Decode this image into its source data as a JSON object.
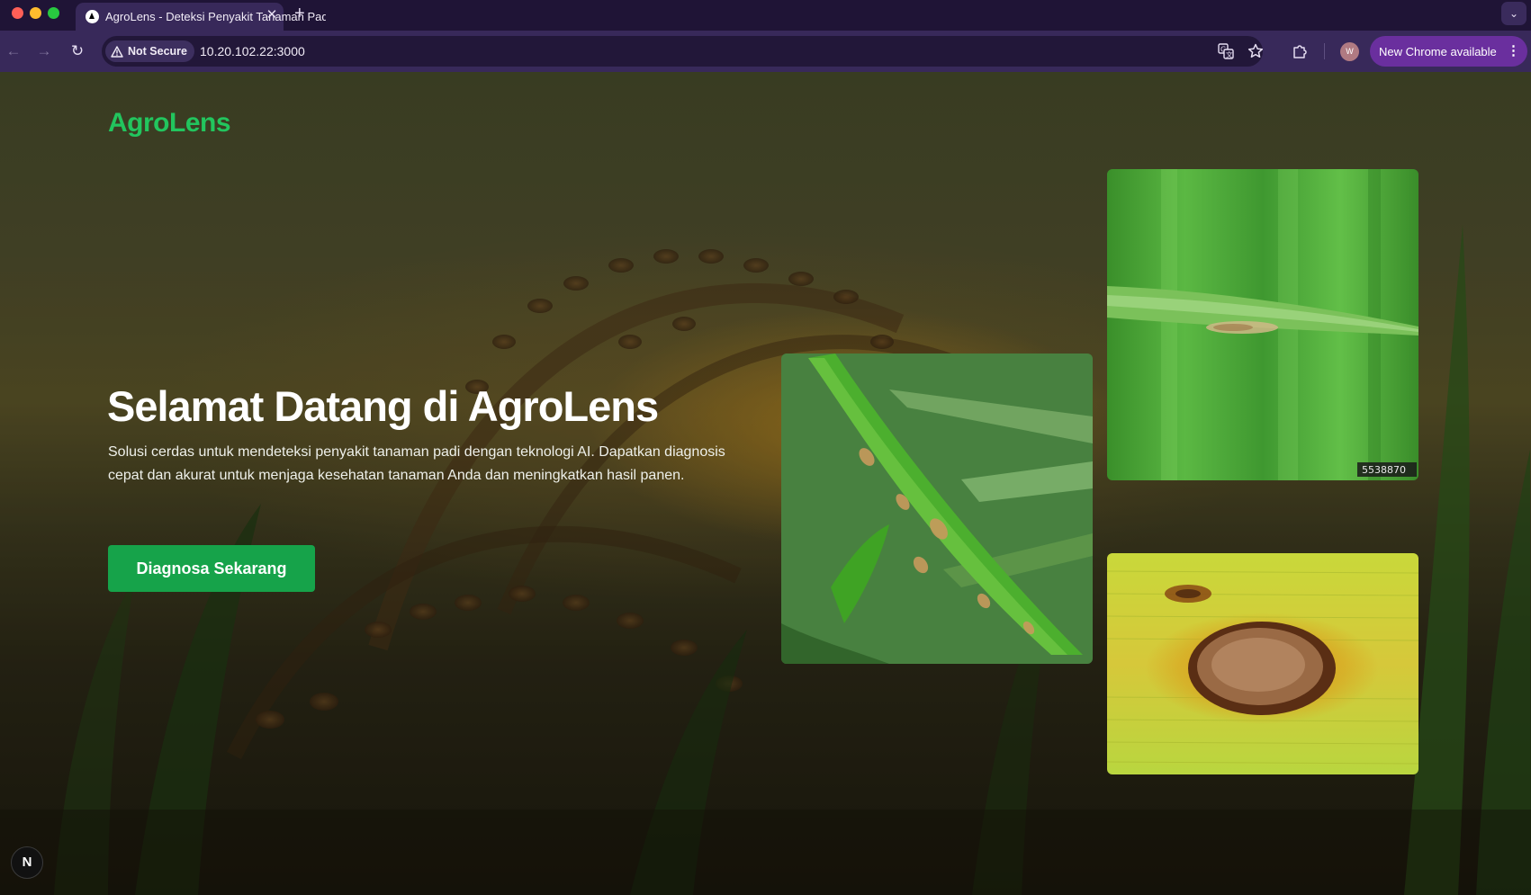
{
  "browser": {
    "tab": {
      "title": "AgroLens - Deteksi Penyakit Tanaman Padi",
      "close_glyph": "✕"
    },
    "new_tab_glyph": "+",
    "tab_menu_glyph": "⌄",
    "nav": {
      "back_glyph": "←",
      "forward_glyph": "→",
      "reload_glyph": "↻"
    },
    "security_label": "Not Secure",
    "url": "10.20.102.22:3000",
    "avatar_initial": "W",
    "update_label": "New Chrome available",
    "update_menu_glyph": "⋮",
    "icons": [
      "warning-triangle-icon",
      "translate-icon",
      "star-icon",
      "extensions-puzzle-icon",
      "kebab-menu-icon"
    ]
  },
  "page": {
    "brand": "AgroLens",
    "hero": {
      "title": "Selamat Datang di AgroLens",
      "description": "Solusi cerdas untuk mendeteksi penyakit tanaman padi dengan teknologi AI. Dapatkan diagnosis cepat dan akurat untuk menjaga kesehatan tanaman Anda dan meningkatkan hasil panen.",
      "cta_label": "Diagnosa Sekarang"
    },
    "photos": [
      {
        "subject": "rice-leaf-brown-spots-photo"
      },
      {
        "subject": "rice-leaf-blast-lesion-photo",
        "watermark": "5538870"
      },
      {
        "subject": "rice-leaf-brown-spot-closeup-photo"
      }
    ],
    "dev_badge": "N"
  },
  "colors": {
    "brand_green": "#22c55e",
    "cta_green": "#16a34a",
    "chrome_bg": "#1f1436",
    "toolbar_bg": "#38295a",
    "update_chip": "#6a2f9e"
  }
}
